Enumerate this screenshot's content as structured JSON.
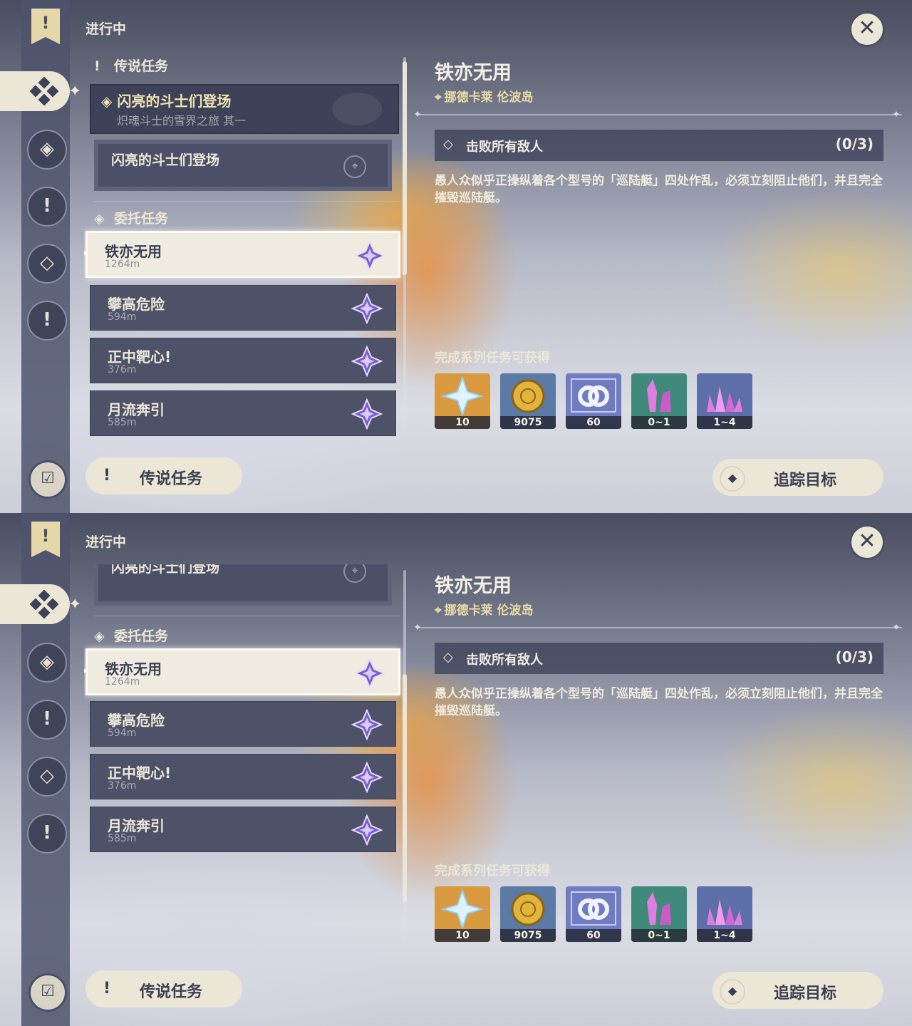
{
  "panels": [
    {
      "header": "进行中",
      "archon_section_title": "传说任务",
      "archon_quest": {
        "title": "闪亮的斗士们登场",
        "subtitle": "炽魂斗士的雪界之旅 其一"
      },
      "archon_step": "闪亮的斗士们登场",
      "commission_section_title": "委托任务",
      "quests": [
        {
          "title": "铁亦无用",
          "distance": "1264m",
          "selected": true
        },
        {
          "title": "攀高危险",
          "distance": "594m",
          "selected": false
        },
        {
          "title": "正中靶心!",
          "distance": "376m",
          "selected": false
        },
        {
          "title": "月流奔引",
          "distance": "585m",
          "selected": false
        }
      ],
      "detail": {
        "title": "铁亦无用",
        "location": "挪德卡莱 伦波岛",
        "objective": "击败所有敌人",
        "objective_count": "(0/3)",
        "description": "愚人众似乎正操纵着各个型号的「巡陆艇」四处作乱，必须立刻阻止他们，并且完全摧毁巡陆艇。",
        "rewards_title": "完成系列任务可获得",
        "rewards": [
          {
            "icon": "primogem-icon",
            "amount": "10"
          },
          {
            "icon": "mora-icon",
            "amount": "9075"
          },
          {
            "icon": "companionship-exp-icon",
            "amount": "60"
          },
          {
            "icon": "crystal-ore-icon",
            "amount": "0~1"
          },
          {
            "icon": "crystal-cluster-icon",
            "amount": "1~4"
          }
        ]
      },
      "bottom_left_button": "传说任务",
      "track_button": "追踪目标"
    },
    {
      "header": "进行中",
      "archon_step": "闪亮的斗士们登场",
      "commission_section_title": "委托任务",
      "quests": [
        {
          "title": "铁亦无用",
          "distance": "1264m",
          "selected": true
        },
        {
          "title": "攀高危险",
          "distance": "594m",
          "selected": false
        },
        {
          "title": "正中靶心!",
          "distance": "376m",
          "selected": false
        },
        {
          "title": "月流奔引",
          "distance": "585m",
          "selected": false
        }
      ],
      "detail": {
        "title": "铁亦无用",
        "location": "挪德卡莱 伦波岛",
        "objective": "击败所有敌人",
        "objective_count": "(0/3)",
        "description": "愚人众似乎正操纵着各个型号的「巡陆艇」四处作乱，必须立刻阻止他们，并且完全摧毁巡陆艇。",
        "rewards_title": "完成系列任务可获得",
        "rewards": [
          {
            "icon": "primogem-icon",
            "amount": "10"
          },
          {
            "icon": "mora-icon",
            "amount": "9075"
          },
          {
            "icon": "companionship-exp-icon",
            "amount": "60"
          },
          {
            "icon": "crystal-ore-icon",
            "amount": "0~1"
          },
          {
            "icon": "crystal-cluster-icon",
            "amount": "1~4"
          }
        ]
      },
      "bottom_left_button": "传说任务",
      "track_button": "追踪目标"
    }
  ],
  "colors": {
    "selected_card": "#efebe0",
    "card": "#4d5269",
    "accent_gold": "#eadba6",
    "reward_gold": "#d8993f"
  }
}
